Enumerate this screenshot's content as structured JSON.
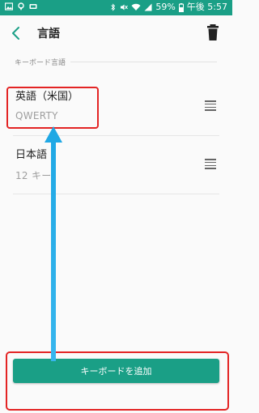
{
  "status_bar": {
    "battery": "59%",
    "time": "午後 5:57",
    "left_icons": [
      "image-icon",
      "location-icon",
      "media-icon"
    ],
    "right_icons": [
      "bluetooth-icon",
      "mute-icon",
      "wifi-icon",
      "signal-icon",
      "battery-icon"
    ]
  },
  "app_bar": {
    "title": "言語",
    "back_icon": "back-arrow-icon",
    "action_icon": "trash-icon"
  },
  "section": {
    "label": "キーボード言語"
  },
  "languages": [
    {
      "title": "英語（米国）",
      "subtitle": "QWERTY"
    },
    {
      "title": "日本語",
      "subtitle": "12 キー"
    }
  ],
  "add_button": {
    "label": "キーボードを追加"
  },
  "colors": {
    "accent": "#1a9f86",
    "highlight": "#e32424",
    "arrow": "#1ea7e4"
  }
}
